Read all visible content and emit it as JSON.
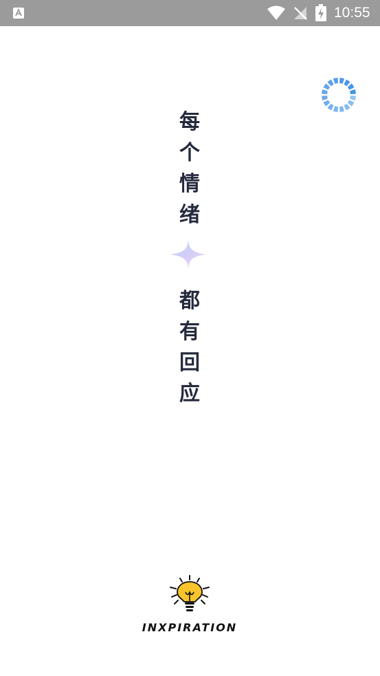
{
  "status_bar": {
    "notification_icon": "app-notification-icon",
    "wifi_icon": "wifi-icon",
    "signal_icon": "no-signal-icon",
    "battery_icon": "battery-charging-icon",
    "time": "10:55"
  },
  "splash": {
    "loading_icon": "loading-spinner-icon",
    "slogan_top": [
      "每",
      "个",
      "情",
      "绪"
    ],
    "slogan_bottom": [
      "都",
      "有",
      "回",
      "应"
    ],
    "sparkle_icon": "sparkle-icon",
    "brand_icon": "lightbulb-icon",
    "brand_name": "INXPIRATION"
  },
  "colors": {
    "status_bar_bg": "#9b9b9b",
    "slogan_text": "#262a3d",
    "spinner_blue": "#3c8ee6",
    "bulb_yellow": "#f7c52a"
  }
}
